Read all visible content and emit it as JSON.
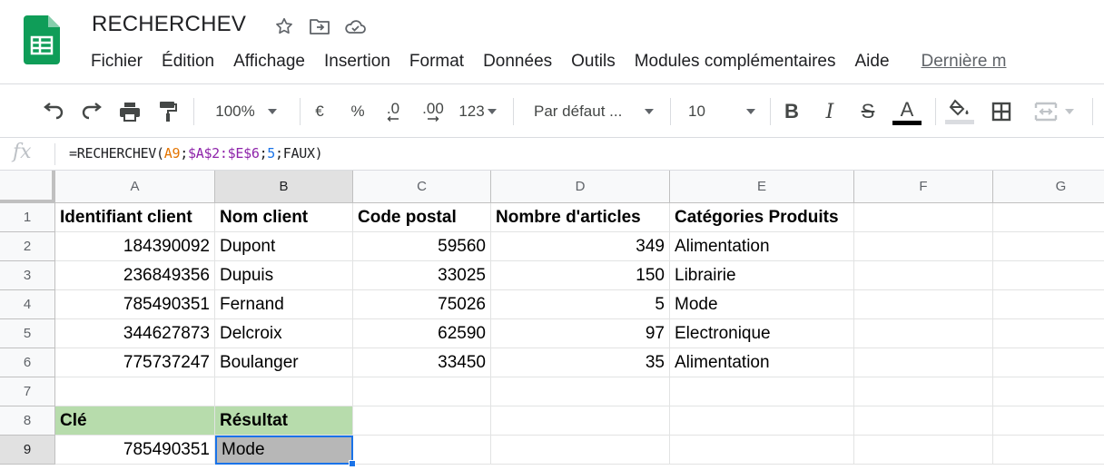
{
  "app": {
    "title": "RECHERCHEV",
    "brand_color": "#0f9d58"
  },
  "title_icons": [
    "star-icon",
    "move-to-folder-icon",
    "cloud-saved-icon"
  ],
  "menu": {
    "items": [
      "Fichier",
      "Édition",
      "Affichage",
      "Insertion",
      "Format",
      "Données",
      "Outils",
      "Modules complémentaires",
      "Aide"
    ],
    "last_edit": "Dernière m"
  },
  "toolbar": {
    "zoom": "100%",
    "currency": "€",
    "percent": "%",
    "decrease_decimals": ".0",
    "increase_decimals": ".00",
    "more_formats": "123",
    "font": "Par défaut ...",
    "font_size": "10",
    "bold": "B",
    "italic": "I",
    "strikethrough": "S",
    "text_color": "A",
    "text_color_value": "#000000"
  },
  "formula_bar": {
    "fx": "fx",
    "parts": [
      "=RECHERCHEV(",
      "A9",
      ";",
      "$A$2:$E$6",
      ";",
      "5",
      ";FAUX)"
    ]
  },
  "columns": [
    "A",
    "B",
    "C",
    "D",
    "E",
    "F",
    "G"
  ],
  "selected_column": "B",
  "rows": [
    "1",
    "2",
    "3",
    "4",
    "5",
    "6",
    "7",
    "8",
    "9"
  ],
  "selected_row": "9",
  "sheet": {
    "header": [
      "Identifiant client",
      "Nom client",
      "Code postal",
      "Nombre d'articles",
      "Catégories Produits"
    ],
    "data": [
      [
        "184390092",
        "Dupont",
        "59560",
        "349",
        "Alimentation"
      ],
      [
        "236849356",
        "Dupuis",
        "33025",
        "150",
        "Librairie"
      ],
      [
        "785490351",
        "Fernand",
        "75026",
        "5",
        "Mode"
      ],
      [
        "344627873",
        "Delcroix",
        "62590",
        "97",
        "Electronique"
      ],
      [
        "775737247",
        "Boulanger",
        "33450",
        "35",
        "Alimentation"
      ]
    ],
    "lookup_header": [
      "Clé",
      "Résultat"
    ],
    "lookup_values": [
      "785490351",
      "Mode"
    ]
  }
}
